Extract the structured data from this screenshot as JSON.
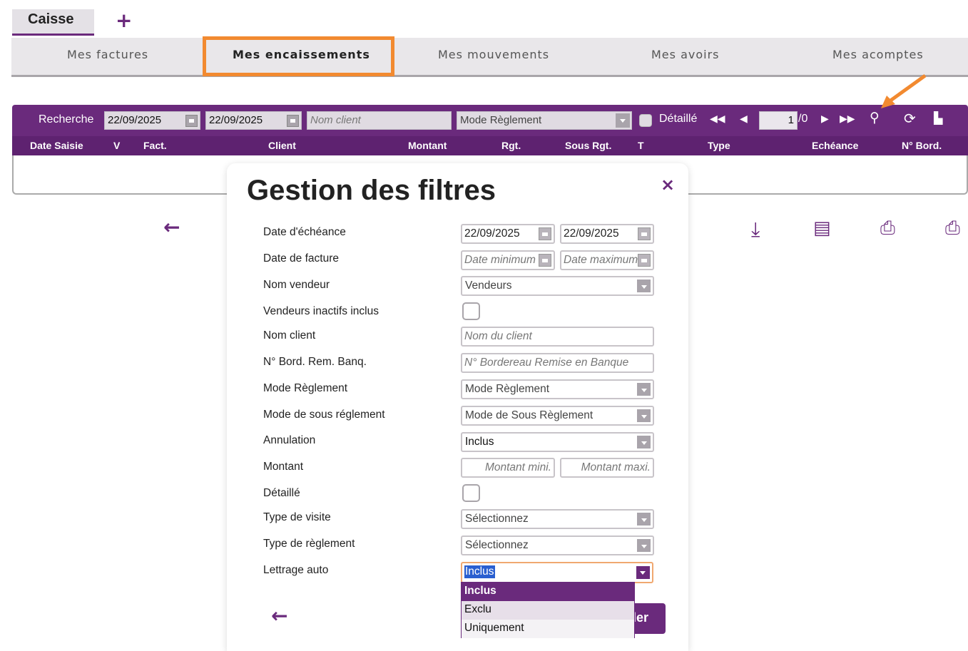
{
  "top_tabs": {
    "active": "Caisse",
    "add": "+"
  },
  "subnav": [
    {
      "label": "Mes factures"
    },
    {
      "label": "Mes encaissements"
    },
    {
      "label": "Mes mouvements"
    },
    {
      "label": "Mes avoirs"
    },
    {
      "label": "Mes acomptes"
    }
  ],
  "search": {
    "label": "Recherche",
    "date_from": "22/09/2025",
    "date_to": "22/09/2025",
    "client_placeholder": "Nom client",
    "mode_reglement": "Mode Règlement",
    "detaille_label": "Détaillé",
    "page_current": "1",
    "page_total": "/0"
  },
  "columns": [
    "Date Saisie",
    "V",
    "Fact.",
    "Client",
    "Montant",
    "Rgt.",
    "Sous Rgt.",
    "T",
    "Type",
    "Echéance",
    "N° Bord."
  ],
  "modal": {
    "title": "Gestion des filtres",
    "close": "×",
    "fields": {
      "date_echeance": {
        "label": "Date d'échéance",
        "from": "22/09/2025",
        "to": "22/09/2025"
      },
      "date_facture": {
        "label": "Date de facture",
        "from_placeholder": "Date minimum",
        "to_placeholder": "Date maximum"
      },
      "nom_vendeur": {
        "label": "Nom vendeur",
        "value": "Vendeurs"
      },
      "vendeurs_inactifs": {
        "label": "Vendeurs inactifs inclus",
        "checked": false
      },
      "nom_client": {
        "label": "Nom client",
        "placeholder": "Nom du client"
      },
      "bord_rem": {
        "label": "N° Bord. Rem. Banq.",
        "placeholder": "N° Bordereau Remise en Banque"
      },
      "mode_reglement": {
        "label": "Mode Règlement",
        "value": "Mode Règlement"
      },
      "mode_sous_reglement": {
        "label": "Mode de sous réglement",
        "value": "Mode de Sous Règlement"
      },
      "annulation": {
        "label": "Annulation",
        "value": "Inclus"
      },
      "montant": {
        "label": "Montant",
        "min_placeholder": "Montant mini.",
        "max_placeholder": "Montant maxi."
      },
      "detaille": {
        "label": "Détaillé",
        "checked": false
      },
      "type_visite": {
        "label": "Type de visite",
        "value": "Sélectionnez"
      },
      "type_reglement": {
        "label": "Type de règlement",
        "value": "Sélectionnez"
      },
      "lettrage_auto": {
        "label": "Lettrage auto",
        "value": "Inclus",
        "options": [
          "Inclus",
          "Exclu",
          "Uniquement"
        ]
      }
    },
    "button_partial": "ler"
  },
  "colors": {
    "brand": "#6a2a7c",
    "highlight": "#f28a30",
    "selection": "#2a5fd0"
  }
}
